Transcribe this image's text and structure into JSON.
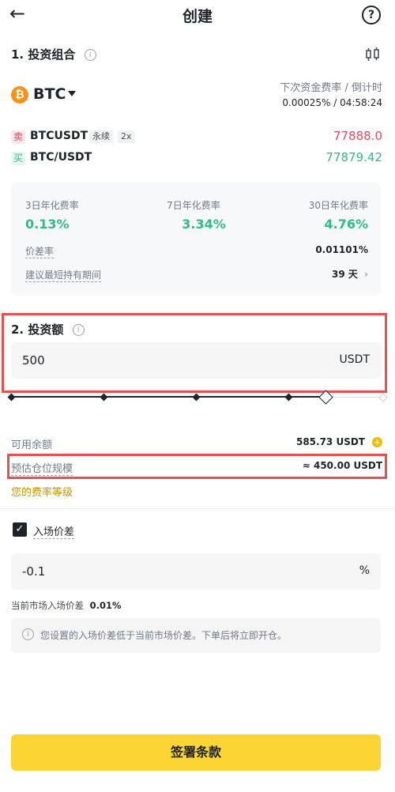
{
  "header": {
    "back_icon": "arrow-left-icon",
    "title": "创建",
    "help_icon": "question-circle-icon"
  },
  "portfolio": {
    "section_title": "1. 投资组合",
    "asset": "BTC",
    "funding_label": "下次资金费率 / 倒计时",
    "funding_value": "0.00025% / 04:58:24",
    "sell": {
      "tag": "卖",
      "pair": "BTCUSDT",
      "chip1": "永续",
      "chip2": "2x",
      "price": "77888.0"
    },
    "buy": {
      "tag": "买",
      "pair": "BTC/USDT",
      "price": "77879.42"
    }
  },
  "stats": {
    "rate3_label": "3日年化费率",
    "rate3_value": "0.13%",
    "rate7_label": "7日年化费率",
    "rate7_value": "3.34%",
    "rate30_label": "30日年化费率",
    "rate30_value": "4.76%",
    "spread_label": "价差率",
    "spread_value": "0.01101%",
    "hold_label": "建议最短持有期间",
    "hold_value": "39 天"
  },
  "investment": {
    "section_title": "2. 投资额",
    "amount": "500",
    "unit": "USDT",
    "slider_fraction": 0.8
  },
  "balance": {
    "available_label": "可用余额",
    "available_value": "585.73 USDT",
    "position_label": "预估仓位规模",
    "position_value": "≈ 450.00 USDT",
    "fee_level": "您的费率等级"
  },
  "entry": {
    "checkbox_label": "入场价差",
    "value": "-0.1",
    "unit": "%",
    "market_label": "当前市场入场价差",
    "market_value": "0.01%",
    "notice": "您设置的入场价差低于当前市场价差。下单后将立即开仓。"
  },
  "actions": {
    "sign_button": "签署条款"
  },
  "colors": {
    "accent": "#fcd535",
    "sell": "#e24b5f",
    "buy": "#2ebd85",
    "highlight": "#e8504f",
    "fee_link": "#c99400"
  }
}
